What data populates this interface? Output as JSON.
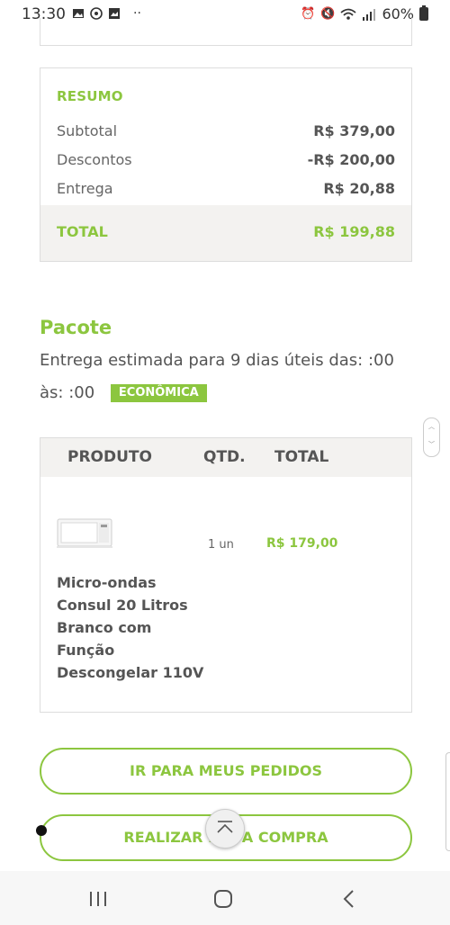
{
  "status_bar": {
    "time": "13:30",
    "battery": "60%",
    "icons": [
      "image-icon",
      "whatsapp-icon",
      "gallery-icon",
      "more-dots-icon",
      "alarm-icon",
      "mute-icon",
      "wifi-icon",
      "signal-icon",
      "battery-icon"
    ]
  },
  "summary": {
    "title": "RESUMO",
    "rows": [
      {
        "label": "Subtotal",
        "value": "R$ 379,00"
      },
      {
        "label": "Descontos",
        "value": "-R$ 200,00"
      },
      {
        "label": "Entrega",
        "value": "R$ 20,88"
      }
    ],
    "total_label": "TOTAL",
    "total_value": "R$ 199,88"
  },
  "package": {
    "title": "Pacote",
    "delivery_text": "Entrega estimada para 9 dias úteis das: :00 às: :00",
    "badge": "ECONÔMICA"
  },
  "products": {
    "columns": [
      "PRODUTO",
      "QTD.",
      "TOTAL"
    ],
    "items": [
      {
        "name": "Micro-ondas Consul 20 Litros Branco com Função Descongelar 110V",
        "qty": "1 un",
        "total": "R$ 179,00"
      }
    ]
  },
  "buttons": {
    "orders": "IR PARA MEUS PEDIDOS",
    "checkout": "REALIZAR NOVA COMPRA"
  },
  "colors": {
    "accent": "#8cc63f",
    "band": "#f3f2f0",
    "text": "#555555"
  }
}
